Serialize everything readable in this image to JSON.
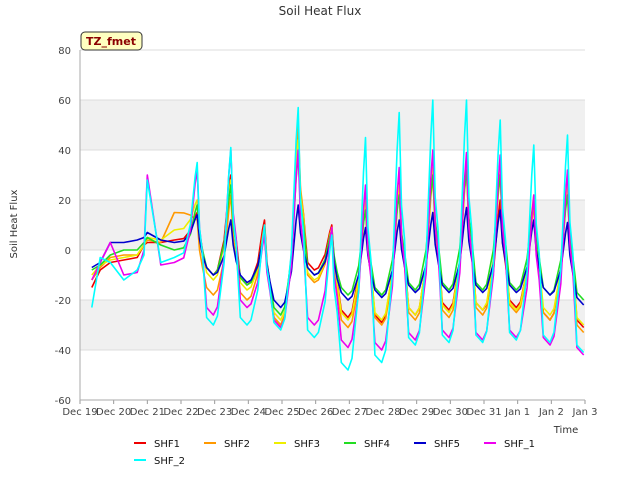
{
  "chart_data": {
    "type": "line",
    "title": "Soil Heat Flux",
    "xlabel": "Time",
    "ylabel": "Soil Heat Flux",
    "site_badge": "TZ_fmet",
    "xlim": [
      0,
      15
    ],
    "ylim": [
      -60,
      80
    ],
    "x_ticks": [
      {
        "pos": 0,
        "label": "Dec 19"
      },
      {
        "pos": 1,
        "label": "Dec 20"
      },
      {
        "pos": 2,
        "label": "Dec 21"
      },
      {
        "pos": 3,
        "label": "Dec 22"
      },
      {
        "pos": 4,
        "label": "Dec 23"
      },
      {
        "pos": 5,
        "label": "Dec 24"
      },
      {
        "pos": 6,
        "label": "Dec 25"
      },
      {
        "pos": 7,
        "label": "Dec 26"
      },
      {
        "pos": 8,
        "label": "Dec 27"
      },
      {
        "pos": 9,
        "label": "Dec 28"
      },
      {
        "pos": 10,
        "label": "Dec 29"
      },
      {
        "pos": 11,
        "label": "Dec 30"
      },
      {
        "pos": 12,
        "label": "Dec 31"
      },
      {
        "pos": 13,
        "label": "Jan 1"
      },
      {
        "pos": 14,
        "label": "Jan 2"
      },
      {
        "pos": 15,
        "label": "Jan 3"
      }
    ],
    "y_ticks": [
      -60,
      -40,
      -20,
      0,
      20,
      40,
      60,
      80
    ],
    "grid": true,
    "shaded_bands": [
      [
        -40,
        -20
      ],
      [
        0,
        20
      ],
      [
        40,
        60
      ]
    ],
    "legend_position": "bottom",
    "daily_peak_x_offset": 0.5,
    "day_starts": [
      3,
      4,
      5,
      6,
      7,
      8,
      9,
      10,
      11,
      12,
      13,
      14
    ],
    "series": [
      {
        "name": "SHF1",
        "color": "#ee0000",
        "start": [
          [
            0.35,
            -15
          ],
          [
            0.6,
            -8
          ],
          [
            0.9,
            -5
          ],
          [
            1.3,
            -4
          ],
          [
            1.7,
            -3
          ],
          [
            1.9,
            2
          ],
          [
            2.0,
            3
          ],
          [
            2.4,
            3
          ],
          [
            2.8,
            4
          ]
        ],
        "peaks": [
          15,
          30,
          12,
          44,
          10,
          22,
          28,
          32,
          33,
          20,
          20,
          28,
          30,
          22
        ],
        "troughs": [
          -10,
          -14,
          -30,
          -8,
          -27,
          -29,
          -26,
          -24,
          -24,
          -23,
          -28,
          -31,
          -23,
          -24
        ]
      },
      {
        "name": "SHF2",
        "color": "#ff9900",
        "start": [
          [
            0.35,
            -12
          ],
          [
            0.6,
            -7
          ],
          [
            0.9,
            -3
          ],
          [
            1.3,
            -2
          ],
          [
            1.7,
            -2
          ],
          [
            1.9,
            2
          ],
          [
            2.0,
            4
          ],
          [
            2.4,
            3
          ],
          [
            2.8,
            15
          ]
        ],
        "peaks": [
          12,
          22,
          10,
          50,
          8,
          18,
          24,
          30,
          32,
          30,
          18,
          25,
          28,
          20
        ],
        "troughs": [
          -18,
          -20,
          -30,
          -13,
          -31,
          -30,
          -28,
          -27,
          -26,
          -25,
          -28,
          -33,
          -25,
          -25
        ]
      },
      {
        "name": "SHF3",
        "color": "#eeee00",
        "start": [
          [
            0.35,
            -10
          ],
          [
            0.6,
            -6
          ],
          [
            0.9,
            -4
          ],
          [
            1.3,
            -3
          ],
          [
            1.7,
            -2
          ],
          [
            1.9,
            2
          ],
          [
            2.0,
            5
          ],
          [
            2.4,
            4
          ],
          [
            2.8,
            8
          ]
        ],
        "peaks": [
          20,
          28,
          8,
          44,
          9,
          20,
          26,
          33,
          34,
          34,
          22,
          26,
          30,
          24
        ],
        "troughs": [
          -12,
          -16,
          -28,
          -12,
          -28,
          -28,
          -26,
          -25,
          -24,
          -24,
          -26,
          -30,
          -24,
          -24
        ]
      },
      {
        "name": "SHF4",
        "color": "#22dd22",
        "start": [
          [
            0.35,
            -8
          ],
          [
            0.6,
            -6
          ],
          [
            0.9,
            -2
          ],
          [
            1.3,
            0
          ],
          [
            1.7,
            0
          ],
          [
            1.9,
            3
          ],
          [
            2.0,
            5
          ],
          [
            2.4,
            2
          ],
          [
            2.8,
            0
          ]
        ],
        "peaks": [
          18,
          26,
          7,
          38,
          8,
          16,
          22,
          30,
          32,
          30,
          20,
          22,
          28,
          20
        ],
        "troughs": [
          -10,
          -14,
          -26,
          -10,
          -18,
          -18,
          -16,
          -16,
          -16,
          -16,
          -18,
          -20,
          -16,
          -16
        ]
      },
      {
        "name": "SHF5",
        "color": "#0000cc",
        "start": [
          [
            0.35,
            -7
          ],
          [
            0.6,
            -5
          ],
          [
            0.9,
            3
          ],
          [
            1.3,
            3
          ],
          [
            1.7,
            4
          ],
          [
            1.9,
            5
          ],
          [
            2.0,
            7
          ],
          [
            2.4,
            4
          ],
          [
            2.8,
            3
          ]
        ],
        "peaks": [
          14,
          12,
          6,
          18,
          5,
          9,
          12,
          15,
          17,
          16,
          12,
          11,
          14,
          14
        ],
        "troughs": [
          -10,
          -13,
          -23,
          -10,
          -20,
          -19,
          -17,
          -17,
          -17,
          -17,
          -18,
          -22,
          -19,
          -17
        ]
      },
      {
        "name": "SHF_1",
        "color": "#ee00ee",
        "start": [
          [
            0.35,
            -12
          ],
          [
            0.6,
            -5
          ],
          [
            0.9,
            3
          ],
          [
            1.3,
            -10
          ],
          [
            1.7,
            -9
          ],
          [
            1.9,
            0
          ],
          [
            2.0,
            30
          ],
          [
            2.4,
            -6
          ],
          [
            2.8,
            -5
          ]
        ],
        "peaks": [
          32,
          40,
          6,
          40,
          9,
          26,
          33,
          40,
          39,
          38,
          22,
          32,
          31,
          38
        ],
        "troughs": [
          -26,
          -23,
          -31,
          -30,
          -39,
          -40,
          -36,
          -35,
          -36,
          -35,
          -38,
          -42,
          -36,
          -35
        ]
      },
      {
        "name": "SHF_2",
        "color": "#00ffff",
        "start": [
          [
            0.35,
            -23
          ],
          [
            0.6,
            -3
          ],
          [
            0.9,
            -5
          ],
          [
            1.3,
            -12
          ],
          [
            1.7,
            -8
          ],
          [
            1.9,
            -2
          ],
          [
            2.0,
            28
          ],
          [
            2.4,
            -5
          ],
          [
            2.8,
            -3
          ]
        ],
        "peaks": [
          35,
          41,
          10,
          57,
          6,
          45,
          55,
          60,
          60,
          52,
          42,
          46,
          52,
          0
        ],
        "troughs": [
          -30,
          -30,
          -32,
          -35,
          -48,
          -45,
          -38,
          -37,
          -37,
          -36,
          -37,
          -41,
          -33,
          -32
        ]
      }
    ]
  }
}
